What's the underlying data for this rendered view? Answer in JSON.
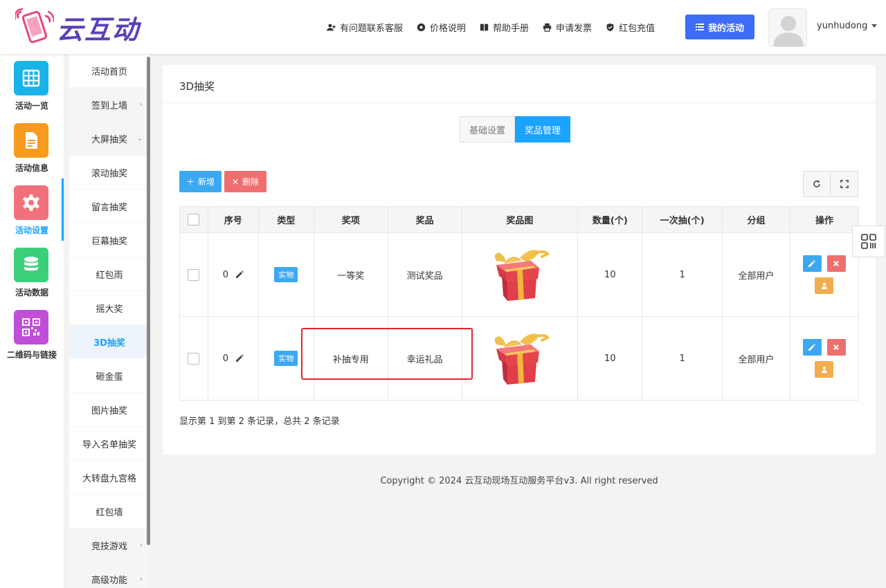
{
  "brand": {
    "name": "云互动"
  },
  "topnav": [
    {
      "label": "有问题联系客服",
      "icon": "add-user-icon"
    },
    {
      "label": "价格说明",
      "icon": "gear-icon"
    },
    {
      "label": "帮助手册",
      "icon": "book-icon"
    },
    {
      "label": "申请发票",
      "icon": "printer-icon"
    },
    {
      "label": "红包充值",
      "icon": "shield-icon"
    }
  ],
  "header": {
    "my_activity": "我的活动",
    "username": "yunhudong"
  },
  "iconnav": [
    {
      "label": "活动一览",
      "color": "#1ab3e8",
      "icon": "grid-icon"
    },
    {
      "label": "活动信息",
      "color": "#f79a1e",
      "icon": "document-icon"
    },
    {
      "label": "活动设置",
      "color": "#f2707c",
      "icon": "gear-icon",
      "active": true
    },
    {
      "label": "活动数据",
      "color": "#3ccf7a",
      "icon": "database-icon"
    },
    {
      "label": "二维码与链接",
      "color": "#c04ed8",
      "icon": "qrcode-icon"
    }
  ],
  "submenu": [
    {
      "label": "活动首页"
    },
    {
      "label": "签到上墙",
      "chevron": "›"
    },
    {
      "label": "大屏抽奖",
      "chevron": "⌄"
    },
    {
      "label": "滚动抽奖"
    },
    {
      "label": "留言抽奖"
    },
    {
      "label": "巨幕抽奖"
    },
    {
      "label": "红包雨"
    },
    {
      "label": "摇大奖"
    },
    {
      "label": "3D抽奖",
      "active": true
    },
    {
      "label": "砸金蛋"
    },
    {
      "label": "图片抽奖"
    },
    {
      "label": "导入名单抽奖"
    },
    {
      "label": "大转盘九宫格"
    },
    {
      "label": "红包墙"
    },
    {
      "label": "竞技游戏",
      "chevron": "›"
    },
    {
      "label": "高级功能",
      "chevron": "›"
    }
  ],
  "panel": {
    "title": "3D抽奖",
    "tabs": [
      "基础设置",
      "奖品管理"
    ],
    "add_label": "新增",
    "delete_label": "删除",
    "columns": [
      "序号",
      "类型",
      "奖项",
      "奖品",
      "奖品图",
      "数量(个)",
      "一次抽(个)",
      "分组",
      "操作"
    ],
    "rows": [
      {
        "seq": "0",
        "type": "实物",
        "award": "一等奖",
        "prize": "测试奖品",
        "qty": "10",
        "per_draw": "1",
        "group": "全部用户"
      },
      {
        "seq": "0",
        "type": "实物",
        "award": "补抽专用",
        "prize": "幸运礼品",
        "qty": "10",
        "per_draw": "1",
        "group": "全部用户"
      }
    ],
    "pager": "显示第 1 到第 2 条记录，总共 2 条记录"
  },
  "footer": {
    "copyright": "Copyright © 2024 云互动现场互动服务平台v3. All right reserved"
  }
}
